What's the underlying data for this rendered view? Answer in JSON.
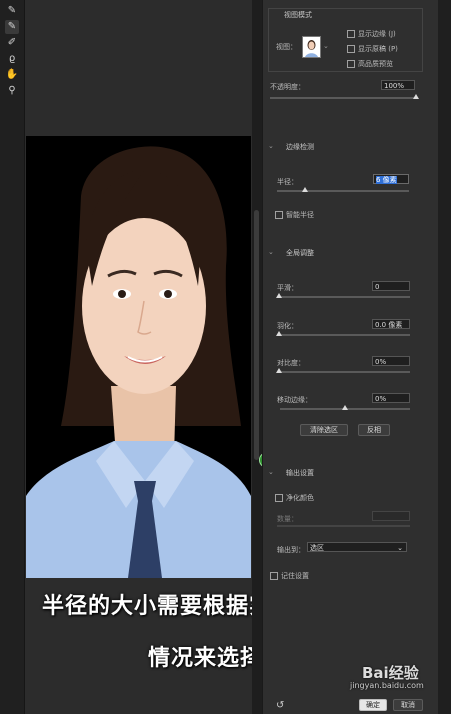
{
  "toolbar": {
    "tools": [
      {
        "name": "quick-selection-tool",
        "glyph": "✎"
      },
      {
        "name": "refine-edge-brush-tool",
        "glyph": "✎"
      },
      {
        "name": "brush-tool",
        "glyph": "✐"
      },
      {
        "name": "lasso-tool",
        "glyph": "ϱ"
      },
      {
        "name": "hand-tool",
        "glyph": "✋"
      },
      {
        "name": "zoom-tool",
        "glyph": "⚲"
      }
    ]
  },
  "panel": {
    "view_mode": {
      "title": "视图模式",
      "view_label": "视图：",
      "show_edge": "显示边缘 (J)",
      "show_original": "显示原稿 (P)",
      "high_quality_preview": "高品质预览"
    },
    "opacity": {
      "label": "不透明度：",
      "value": "100%",
      "level": 1.0
    },
    "edge_detection": {
      "title": "边缘检测",
      "radius_label": "半径：",
      "radius_value": "6 像素",
      "radius_level": 0.2,
      "smart_radius": "智能半径"
    },
    "global_refinements": {
      "title": "全局调整",
      "smooth_label": "平滑：",
      "smooth_value": "0",
      "smooth_level": 0,
      "feather_label": "羽化：",
      "feather_value": "0.0 像素",
      "feather_level": 0,
      "contrast_label": "对比度：",
      "contrast_value": "0%",
      "contrast_level": 0,
      "shift_edge_label": "移动边缘：",
      "shift_edge_value": "0%",
      "shift_edge_level": 0.5,
      "clear_selection": "清除选区",
      "invert": "反相"
    },
    "output_settings": {
      "title": "输出设置",
      "decontaminate": "净化颜色",
      "amount_label": "数量：",
      "output_to_label": "输出到：",
      "output_to_value": "选区",
      "remember_settings": "记住设置"
    },
    "footer": {
      "ok": "确定",
      "cancel": "取消"
    }
  },
  "caption": {
    "line1": "半径的大小需要根据实际的",
    "line2": "情况来选择"
  },
  "watermark": {
    "brand": "Bai经验",
    "url": "jingyan.baidu.com"
  }
}
